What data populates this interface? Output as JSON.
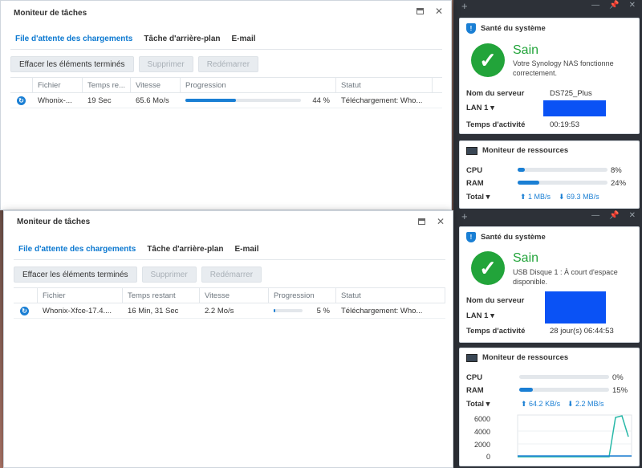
{
  "top": {
    "window": {
      "title": "Moniteur de tâches",
      "tabs": [
        "File d'attente des chargements",
        "Tâche d'arrière-plan",
        "E-mail"
      ],
      "buttons": {
        "clear": "Effacer les éléments terminés",
        "delete": "Supprimer",
        "restart": "Redémarrer"
      },
      "columns": [
        "Fichier",
        "Temps re...",
        "Vitesse",
        "Progression",
        "Statut"
      ],
      "row": {
        "file": "Whonix-...",
        "time": "19 Sec",
        "speed": "65.6 Mo/s",
        "progress": 44,
        "progress_text": "44 %",
        "status": "Téléchargement: Who..."
      }
    },
    "health": {
      "title": "Santé du système",
      "status": "Sain",
      "description": "Votre Synology NAS fonctionne correctement.",
      "server_label": "Nom du serveur",
      "server_value": "DS725_Plus",
      "lan_label": "LAN 1 ▾",
      "uptime_label": "Temps d'activité",
      "uptime_value": "00:19:53"
    },
    "resources": {
      "title": "Moniteur de ressources",
      "cpu_label": "CPU",
      "cpu_pct": 8,
      "cpu_text": "8%",
      "ram_label": "RAM",
      "ram_pct": 24,
      "ram_text": "24%",
      "total_label": "Total ▾",
      "upload": "1 MB/s",
      "download": "69.3 MB/s"
    }
  },
  "bottom": {
    "window": {
      "title": "Moniteur de tâches",
      "tabs": [
        "File d'attente des chargements",
        "Tâche d'arrière-plan",
        "E-mail"
      ],
      "buttons": {
        "clear": "Effacer les éléments terminés",
        "delete": "Supprimer",
        "restart": "Redémarrer"
      },
      "columns": [
        "Fichier",
        "Temps restant",
        "Vitesse",
        "Progression",
        "Statut"
      ],
      "row": {
        "file": "Whonix-Xfce-17.4....",
        "time": "16 Min, 31 Sec",
        "speed": "2.2 Mo/s",
        "progress": 5,
        "progress_text": "5 %",
        "status": "Téléchargement: Who..."
      }
    },
    "health": {
      "title": "Santé du système",
      "status": "Sain",
      "description": "USB Disque 1 : À court d'espace disponible.",
      "server_label": "Nom du serveur",
      "lan_label": "LAN 1 ▾",
      "uptime_label": "Temps d'activité",
      "uptime_value": "28 jour(s) 06:44:53"
    },
    "resources": {
      "title": "Moniteur de ressources",
      "cpu_label": "CPU",
      "cpu_pct": 0,
      "cpu_text": "0%",
      "ram_label": "RAM",
      "ram_pct": 15,
      "ram_text": "15%",
      "total_label": "Total ▾",
      "upload": "64.2 KB/s",
      "download": "2.2 MB/s",
      "chart_ticks": [
        "6000",
        "4000",
        "2000",
        "0"
      ]
    }
  },
  "icons": {
    "add": "plus-icon",
    "pin": "pin-icon",
    "close": "close-icon",
    "maximize": "maximize-icon",
    "download": "download-icon",
    "shield": "shield-icon",
    "check": "check-icon",
    "monitor": "monitor-icon"
  },
  "colors": {
    "accent": "#1a7fd4",
    "healthy": "#22a43a",
    "redacted": "#0a52f5"
  }
}
